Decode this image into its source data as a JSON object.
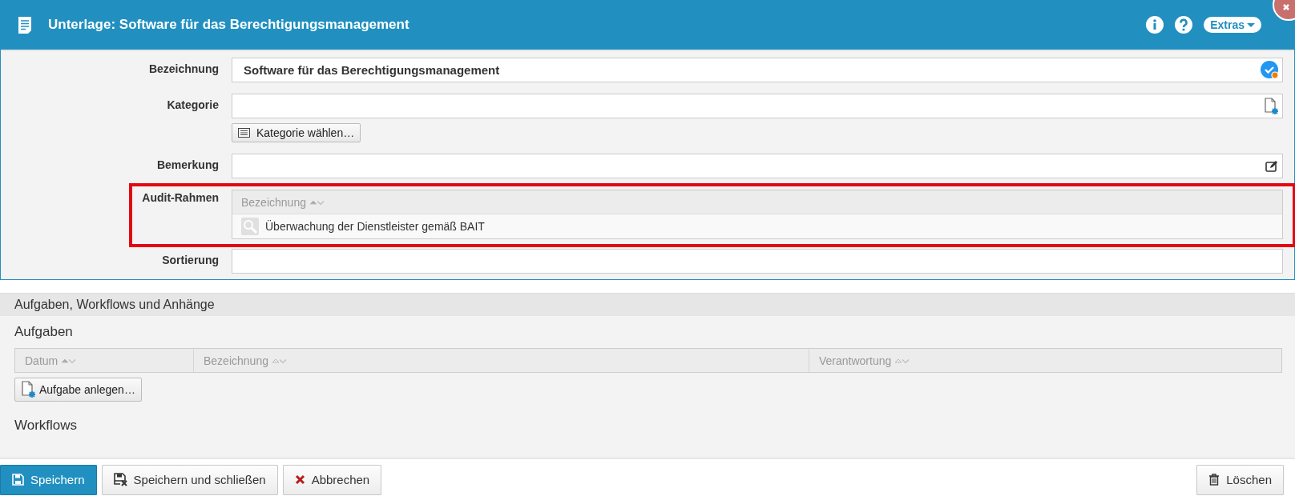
{
  "window": {
    "title": "Unterlage: Software für das Berechtigungsmanagement",
    "extras_button": "Extras"
  },
  "form": {
    "fields": [
      {
        "label": "Bezeichnung",
        "kind": "text",
        "value": "Software für das Berechtigungsmanagement"
      },
      {
        "label": "Kategorie",
        "kind": "text",
        "button": "Kategorie wählen…"
      },
      {
        "label": "Bemerkung",
        "kind": "text"
      },
      {
        "label": "Audit-Rahmen",
        "kind": "table",
        "highlighted": true,
        "columns": [
          {
            "label": "Bezeichnung",
            "sorted": true
          }
        ],
        "rows": [
          "Überwachung der Dienstleister gemäß BAIT"
        ]
      },
      {
        "label": "Sortierung",
        "kind": "text"
      }
    ]
  },
  "section": {
    "title": "Aufgaben, Workflows und Anhänge",
    "tasks": {
      "heading": "Aufgaben",
      "columns": [
        {
          "label": "Datum",
          "sorted": true
        },
        {
          "label": "Bezeichnung",
          "sorted": false
        },
        {
          "label": "Verantwortung",
          "sorted": false
        }
      ],
      "button": "Aufgabe anlegen…"
    },
    "workflows": {
      "heading": "Workflows"
    }
  },
  "footer": {
    "buttons": [
      {
        "label": "Speichern",
        "kind": "primary"
      },
      {
        "label": "Speichern und schließen",
        "kind": "default"
      },
      {
        "label": "Abbrechen",
        "kind": "default"
      }
    ],
    "delete_button": "Löschen"
  }
}
